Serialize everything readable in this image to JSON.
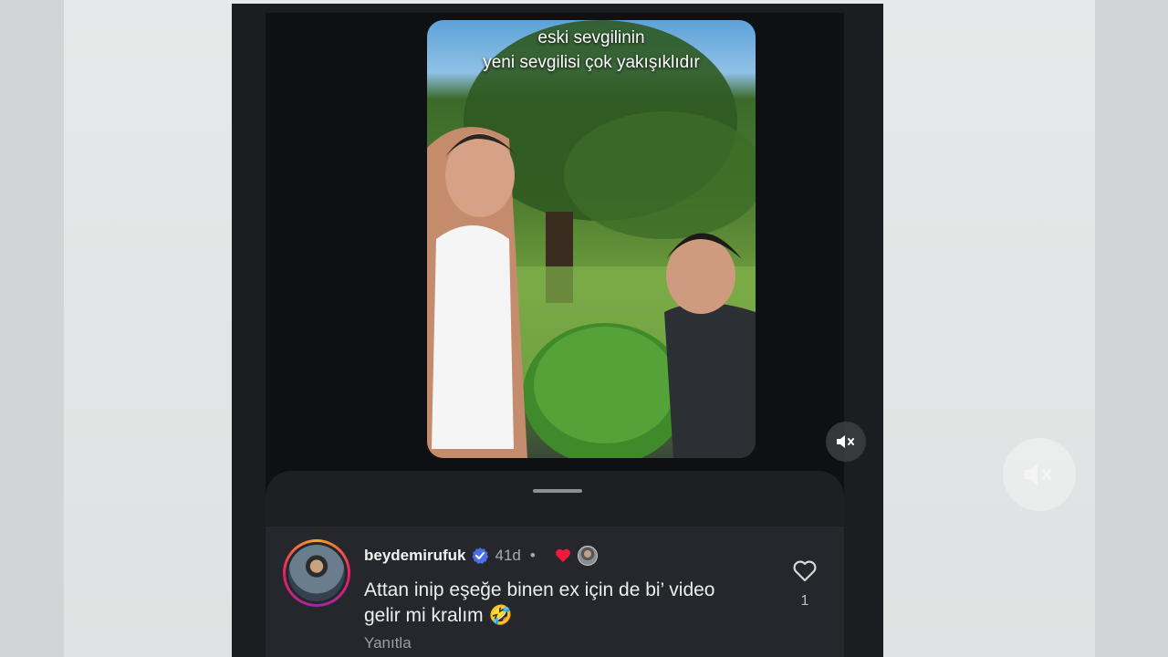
{
  "video": {
    "caption_line1": "eski sevgilinin",
    "caption_line2": "yeni sevgilisi çok yakışıklıdır",
    "mute_icon": "muted-speaker-icon"
  },
  "comment": {
    "username": "beydemirufuk",
    "verified_icon": "verified-badge-icon",
    "age": "41d",
    "separator": "•",
    "reaction_icon": "red-heart-icon",
    "text": "Attan inip eşeğe binen ex için de bi’ video gelir mi kralım 🤣",
    "reply_label": "Yanıtla",
    "like_icon": "heart-outline-icon",
    "like_count": "1"
  },
  "colors": {
    "verified": "#4b6fe8",
    "reaction_heart": "#ed1c3a",
    "page_bg": "#dcdedf",
    "panel_bg": "#1b1d21"
  }
}
